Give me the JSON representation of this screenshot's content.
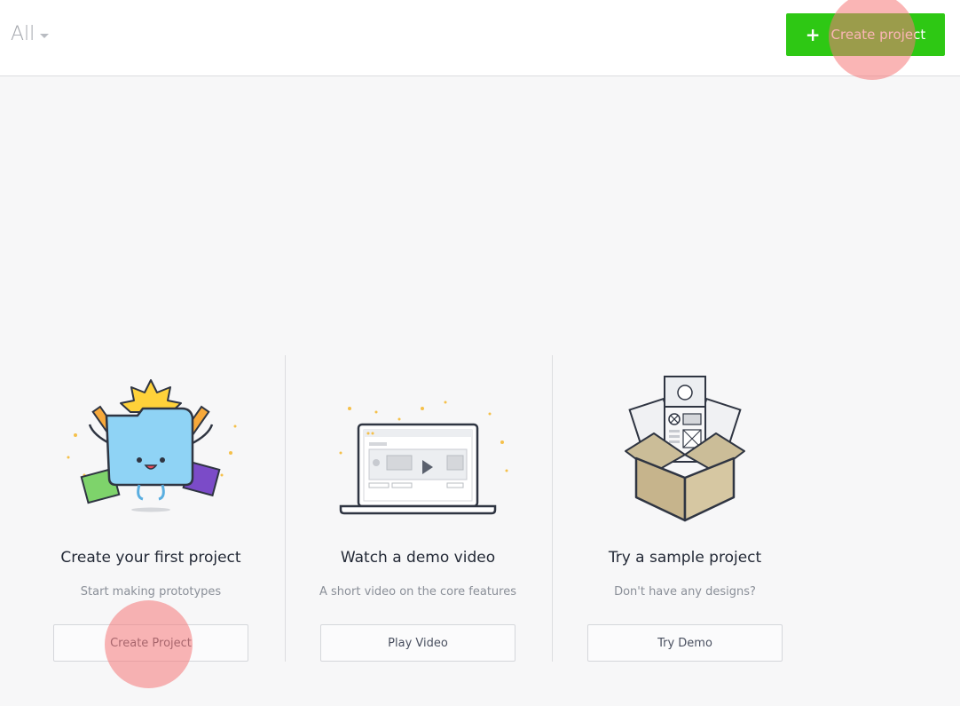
{
  "header": {
    "filter_label": "All",
    "create_label": "Create project",
    "create_color": "#2ec814"
  },
  "cards": [
    {
      "icon": "folder-mascot-illustration",
      "title": "Create your first project",
      "subtitle": "Start making prototypes",
      "button": "Create Project"
    },
    {
      "icon": "laptop-video-illustration",
      "title": "Watch a demo video",
      "subtitle": "A short video on the core features",
      "button": "Play Video"
    },
    {
      "icon": "sample-box-illustration",
      "title": "Try a sample project",
      "subtitle": "Don't have any designs?",
      "button": "Try Demo"
    }
  ]
}
